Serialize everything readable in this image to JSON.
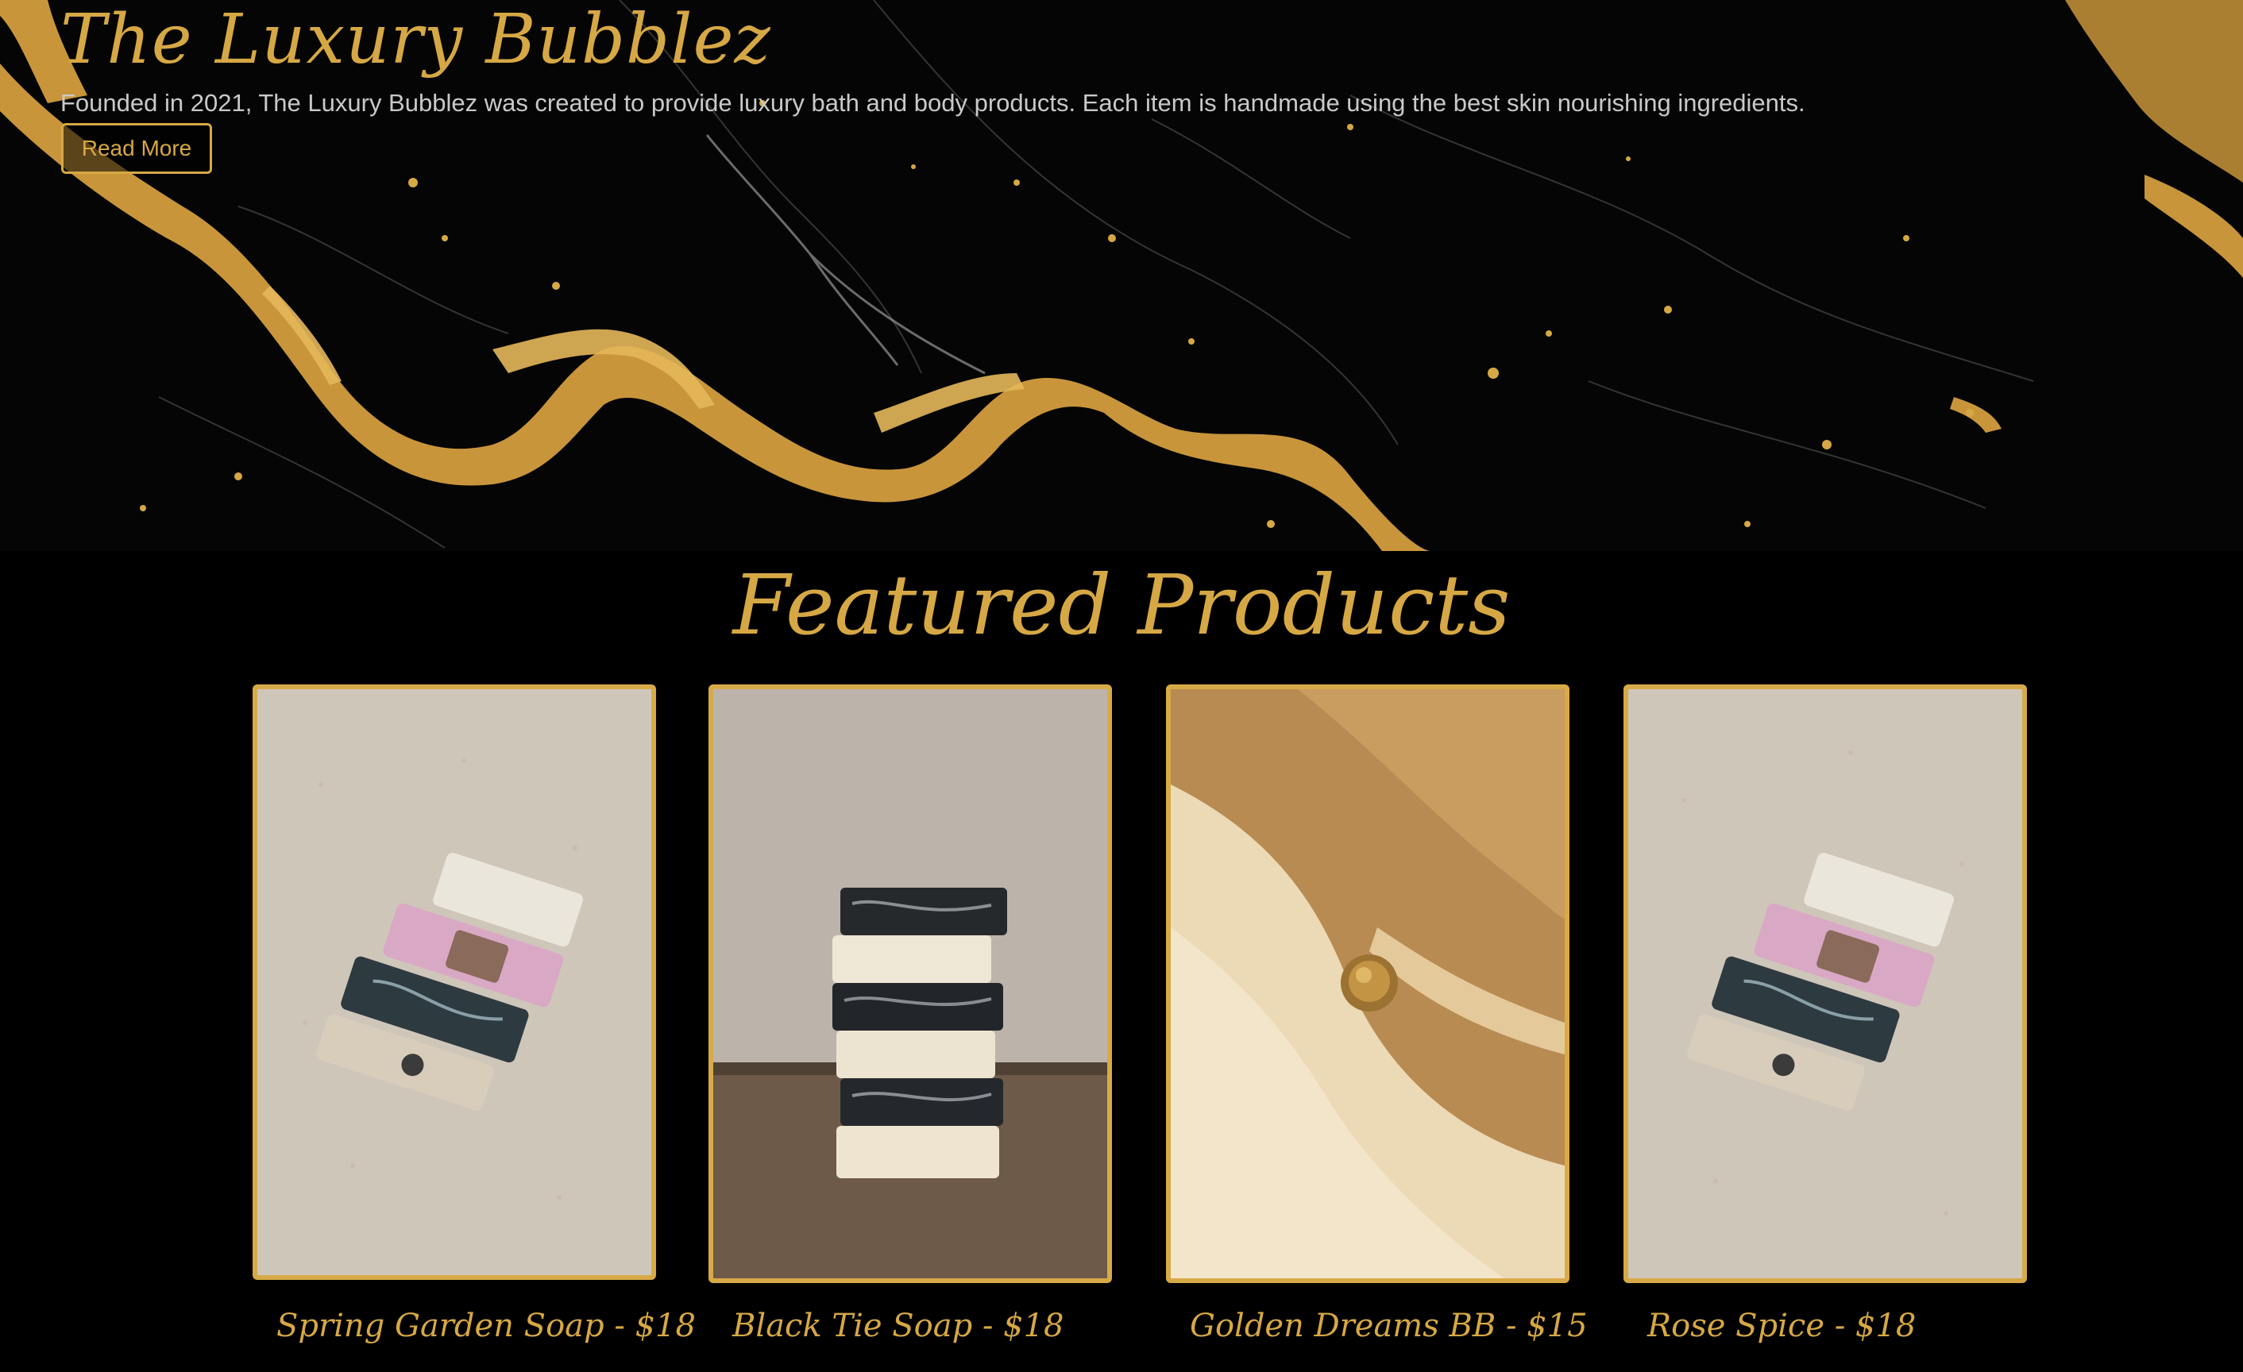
{
  "hero": {
    "title": "The Luxury Bubblez",
    "description": "Founded in 2021, The Luxury Bubblez was created to provide luxury bath and body products. Each item is handmade using the best skin nourishing ingredients.",
    "read_more_label": "Read More"
  },
  "featured": {
    "title": "Featured Products",
    "products": [
      {
        "name": "Spring Garden Soap",
        "price": "$18",
        "caption": "Spring Garden Soap - $18"
      },
      {
        "name": "Black Tie Soap",
        "price": "$18",
        "caption": "Black Tie Soap - $18"
      },
      {
        "name": "Golden Dreams BB",
        "price": "$15",
        "caption": "Golden Dreams BB - $15"
      },
      {
        "name": "Rose Spice",
        "price": "$18",
        "caption": "Rose Spice - $18"
      }
    ]
  },
  "colors": {
    "background": "#000000",
    "gold": "#d6a845",
    "body_text": "#c9c9c9"
  }
}
